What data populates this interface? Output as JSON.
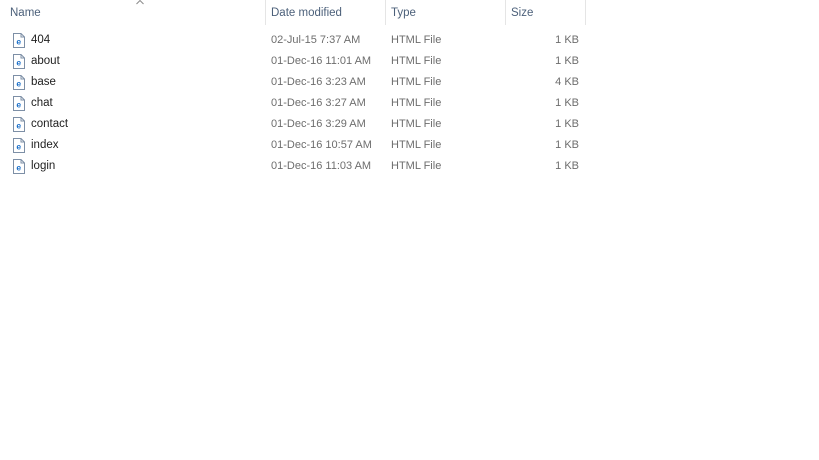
{
  "columns": {
    "name": "Name",
    "date_modified": "Date modified",
    "type": "Type",
    "size": "Size"
  },
  "sort": {
    "column": "name",
    "direction": "ascending",
    "icon": "chevron-up-icon"
  },
  "file_icon": "html-file-icon",
  "files": [
    {
      "name": "404",
      "date_modified": "02-Jul-15 7:37 AM",
      "type": "HTML File",
      "size": "1 KB"
    },
    {
      "name": "about",
      "date_modified": "01-Dec-16 11:01 AM",
      "type": "HTML File",
      "size": "1 KB"
    },
    {
      "name": "base",
      "date_modified": "01-Dec-16 3:23 AM",
      "type": "HTML File",
      "size": "4 KB"
    },
    {
      "name": "chat",
      "date_modified": "01-Dec-16 3:27 AM",
      "type": "HTML File",
      "size": "1 KB"
    },
    {
      "name": "contact",
      "date_modified": "01-Dec-16 3:29 AM",
      "type": "HTML File",
      "size": "1 KB"
    },
    {
      "name": "index",
      "date_modified": "01-Dec-16 10:57 AM",
      "type": "HTML File",
      "size": "1 KB"
    },
    {
      "name": "login",
      "date_modified": "01-Dec-16 11:03 AM",
      "type": "HTML File",
      "size": "1 KB"
    }
  ]
}
